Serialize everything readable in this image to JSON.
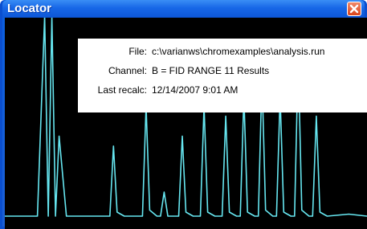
{
  "window": {
    "title": "Locator"
  },
  "info": {
    "file_label": "File:",
    "file_value": "c:\\varianws\\chromexamples\\analysis.run",
    "channel_label": "Channel:",
    "channel_value": "B = FID RANGE 11 Results",
    "recalc_label": "Last recalc:",
    "recalc_value": "12/14/2007 9:01 AM"
  },
  "colors": {
    "trace": "#66e6f0",
    "plot_background": "#000000",
    "titlebar": "#1767e7",
    "close_button": "#d9431b"
  },
  "icons": {
    "close": "close-icon"
  },
  "chart_data": {
    "type": "line",
    "series_color": "#66e6f0",
    "x": [
      0,
      9,
      11,
      12,
      13,
      14,
      15,
      17,
      29,
      30,
      31,
      33,
      38,
      39,
      40,
      42,
      43,
      44,
      45,
      46,
      48,
      49,
      50,
      52,
      54,
      55,
      56,
      58,
      60,
      61,
      62,
      64,
      65,
      66,
      67,
      69,
      70,
      71,
      72,
      74,
      75,
      76,
      77,
      79,
      80,
      81,
      82,
      84,
      85,
      86,
      87,
      89,
      95,
      100
    ],
    "y": [
      0,
      0,
      100,
      0,
      100,
      0,
      40,
      0,
      0,
      35,
      2,
      0,
      0,
      55,
      3,
      0,
      0,
      12,
      0,
      0,
      0,
      40,
      2,
      0,
      0,
      55,
      2,
      0,
      0,
      50,
      2,
      0,
      0,
      60,
      2,
      0,
      0,
      70,
      3,
      0,
      0,
      60,
      2,
      0,
      0,
      80,
      3,
      0,
      0,
      50,
      2,
      0,
      1,
      0
    ]
  }
}
